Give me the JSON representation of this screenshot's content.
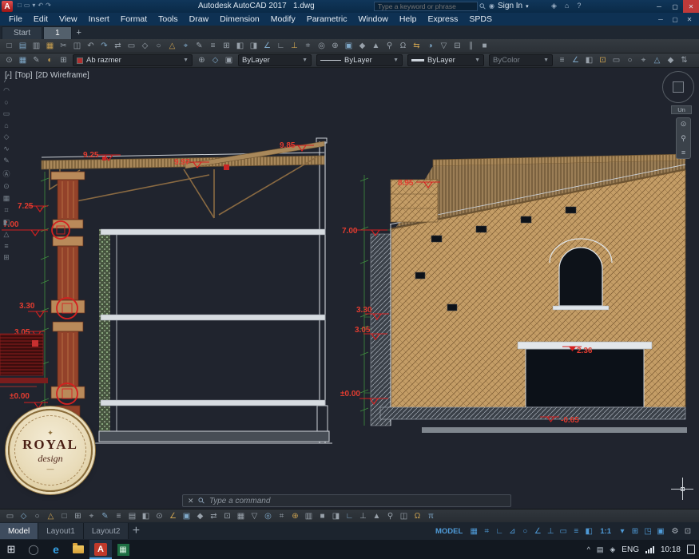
{
  "titlebar": {
    "logo": "A",
    "title": "Autodesk AutoCAD 2017",
    "doc": "1.dwg",
    "search_placeholder": "Type a keyword or phrase",
    "sign_in": "Sign In"
  },
  "menubar": {
    "items": [
      "File",
      "Edit",
      "View",
      "Insert",
      "Format",
      "Tools",
      "Draw",
      "Dimension",
      "Modify",
      "Parametric",
      "Window",
      "Help",
      "Express",
      "SPDS"
    ]
  },
  "file_tabs": {
    "start": "Start",
    "doc": "1",
    "add": "+"
  },
  "toolbars": {
    "layer": "Ab razmer",
    "color": "ByLayer",
    "linetype": "ByLayer",
    "lineweight": "ByLayer",
    "plot_style": "ByColor"
  },
  "viewport": {
    "controls": "[-]",
    "view": "[Top]",
    "style": "[2D Wireframe]"
  },
  "viewcube_label": "Un",
  "command": {
    "placeholder": "Type a command"
  },
  "layout_tabs": {
    "items": [
      "Model",
      "Layout1",
      "Layout2"
    ],
    "add": "+"
  },
  "statusbar": {
    "model": "MODEL",
    "scale": "1:1"
  },
  "taskbar": {
    "lang": "ENG",
    "time": "10:18"
  },
  "logo_stamp": {
    "title": "ROYAL",
    "subtitle": "design"
  },
  "dims": {
    "left": {
      "d925": "9.25",
      "d997": "9.97",
      "d985": "9.85",
      "d725": "7.25",
      "d700": "7.00",
      "d330": "3.30",
      "d305": "3.05",
      "d000": "±0.00"
    },
    "right": {
      "d895": "8.95",
      "d700": "7.00",
      "d330": "3.30",
      "d305": "3.05",
      "d000": "±0.00",
      "d236": "2.36",
      "dm065": "-0.65"
    }
  },
  "icons": {
    "minimize": "─",
    "maximize": "▢",
    "close": "✕",
    "person": "◉",
    "caret": "▾",
    "search": "⚲",
    "cmd_close": "✕",
    "logo_ornament": "✦",
    "logo_flourish": "—",
    "qat": [
      "□",
      "▭",
      "▾",
      "↶",
      "↷"
    ],
    "titlebar_extra": [
      "◈",
      "⌂",
      "?"
    ],
    "doc_win": [
      "─",
      "▢",
      "✕"
    ],
    "tb1": [
      "□",
      "▤",
      "▥",
      "▦",
      "✂",
      "◫",
      "↶",
      "↷",
      "⇄",
      "▭",
      "◇",
      "○",
      "△",
      "⌖",
      "✎",
      "≡",
      "⊞",
      "◧",
      "◨",
      "∠",
      "∟",
      "⊥",
      "⌗",
      "◎",
      "⊕",
      "▣",
      "◆",
      "▲",
      "⚲",
      "Ω",
      "⇆",
      "◑",
      "▽",
      "⊟",
      "∥",
      "■"
    ],
    "tb2_left": [
      "⊙",
      "▦",
      "✎",
      "◐",
      "⊞"
    ],
    "tb2_mid": [
      "⊕",
      "◇",
      "▣"
    ],
    "tb2_right": [
      "≡",
      "∠",
      "◧",
      "⊡",
      "▭",
      "○",
      "⌖",
      "△",
      "◆",
      "⇅"
    ],
    "tb3": [
      "▭",
      "◇",
      "○",
      "△",
      "□",
      "⊞",
      "⌖",
      "✎",
      "≡",
      "▤",
      "◧",
      "⊙",
      "∠",
      "▣",
      "◆",
      "⇄",
      "⊡",
      "▦",
      "▽",
      "◎",
      "⌗",
      "⊕",
      "▥",
      "■",
      "◨",
      "∟",
      "⊥",
      "▲",
      "⚲",
      "◫",
      "Ω",
      "π"
    ],
    "left_col": [
      "╱",
      "◠",
      "○",
      "▭",
      "⌂",
      "◇",
      "∿",
      "✎",
      "Ⓐ",
      "⊙",
      "▦",
      "⌗",
      "◧",
      "△",
      "≡",
      "⊞"
    ],
    "nav": [
      "⊙",
      "⚲",
      "≡"
    ],
    "status_a": [
      "▦",
      "⌗",
      "∟",
      "⊿",
      "○",
      "∠",
      "⊥",
      "▭",
      "≡",
      "◧"
    ],
    "status_b": [
      "▾",
      "⊞",
      "◳",
      "▣"
    ],
    "status_c": [
      "⚙",
      "⊡"
    ],
    "tray": [
      "^",
      "▤",
      "◈"
    ]
  }
}
